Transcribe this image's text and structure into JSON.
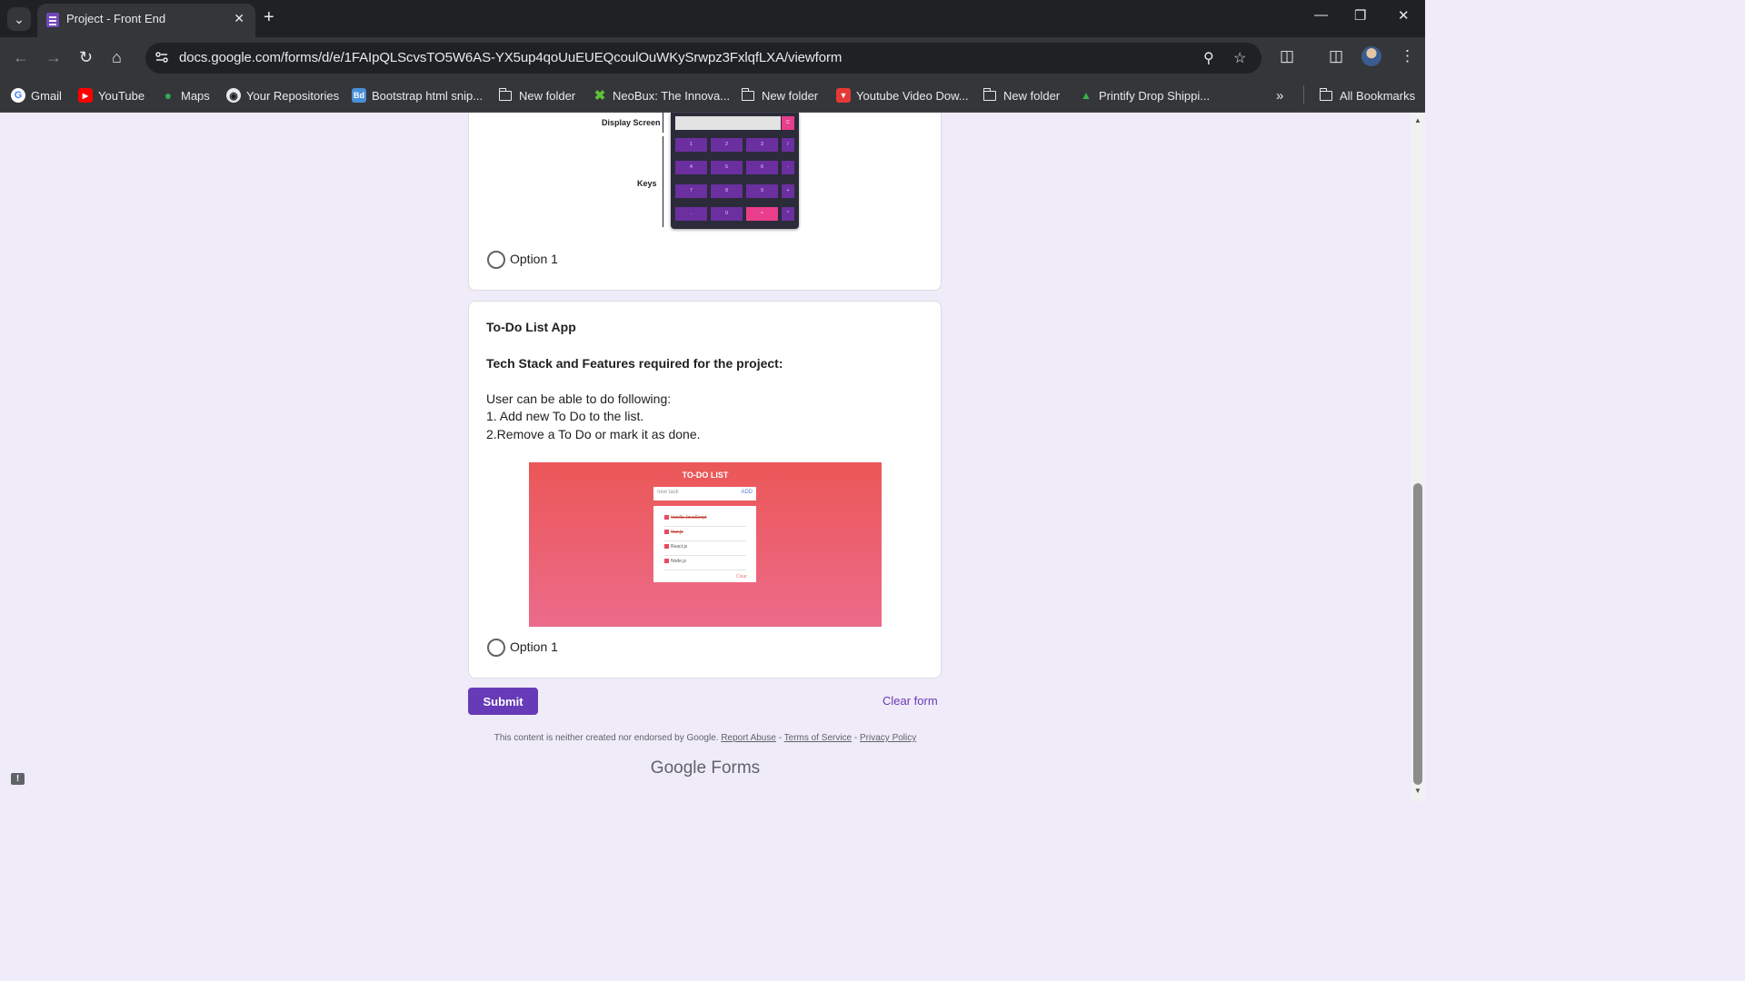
{
  "browser": {
    "tab_title": "Project - Front End",
    "url": "docs.google.com/forms/d/e/1FAIpQLScvsTO5W6AS-YX5up4qoUuEUEQcoulOuWKySrwpz3FxlqfLXA/viewform",
    "bookmarks": [
      {
        "label": "Gmail",
        "icon": "google-icon"
      },
      {
        "label": "YouTube",
        "icon": "youtube-icon"
      },
      {
        "label": "Maps",
        "icon": "maps-icon"
      },
      {
        "label": "Your Repositories",
        "icon": "github-icon"
      },
      {
        "label": "Bootstrap html snip...",
        "icon": "bootstrap-icon"
      },
      {
        "label": "New folder",
        "icon": "folder-icon"
      },
      {
        "label": "NeoBux: The Innova...",
        "icon": "neobux-icon"
      },
      {
        "label": "New folder",
        "icon": "folder-icon"
      },
      {
        "label": "Youtube Video Dow...",
        "icon": "download-icon"
      },
      {
        "label": "New folder",
        "icon": "folder-icon"
      },
      {
        "label": "Printify Drop Shippi...",
        "icon": "printify-icon"
      }
    ],
    "all_bookmarks": "All Bookmarks"
  },
  "calculator_image": {
    "display_label": "Display Screen",
    "keys_label": "Keys",
    "clear_key": "C",
    "keys": [
      "1",
      "2",
      "3",
      "/",
      "4",
      "5",
      "6",
      "-",
      "7",
      "8",
      "9",
      "+",
      ".",
      "0",
      "=",
      "*"
    ]
  },
  "question1": {
    "option": "Option 1"
  },
  "question2": {
    "title": "To-Do List App",
    "subtitle": "Tech Stack and Features required for the project:",
    "intro": "User can be able to do following:",
    "line1": "1. Add new To Do to the list.",
    "line2": "2.Remove a To Do or mark it as done.",
    "option": "Option 1"
  },
  "todo_image": {
    "title": "TO-DO LIST",
    "placeholder": "new task",
    "add": "ADD",
    "items": [
      {
        "text": "Vanilla JavaScript",
        "done": true
      },
      {
        "text": "Vue.js",
        "done": true
      },
      {
        "text": "React.js",
        "done": false
      },
      {
        "text": "Node.js",
        "done": false
      }
    ],
    "clear": "Clear"
  },
  "form_actions": {
    "submit": "Submit",
    "clear_form": "Clear form"
  },
  "footer": {
    "notice": "This content is neither created nor endorsed by Google.",
    "report_abuse": "Report Abuse",
    "terms": "Terms of Service",
    "privacy": "Privacy Policy",
    "brand_google": "Google",
    "brand_forms": "Forms"
  }
}
